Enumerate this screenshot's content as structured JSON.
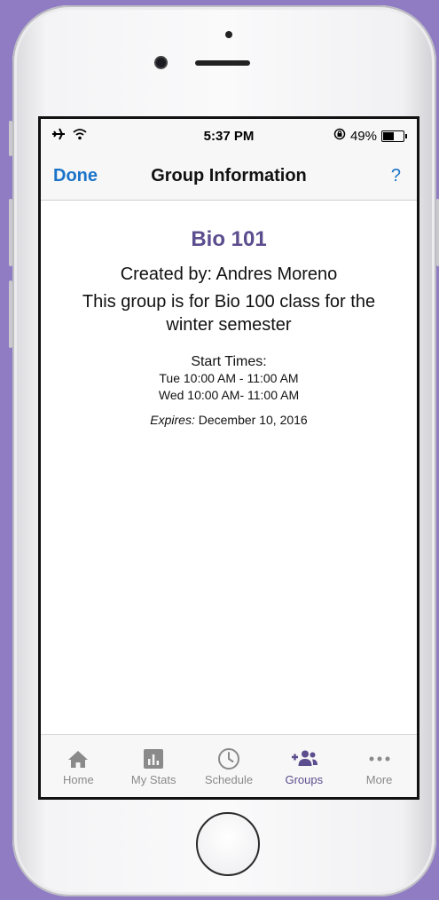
{
  "status_bar": {
    "time": "5:37 PM",
    "battery": "49%",
    "battery_level": 0.49,
    "icons": [
      "airplane-icon",
      "wifi-icon",
      "orientation-lock-icon",
      "battery-icon"
    ]
  },
  "nav": {
    "done_label": "Done",
    "title": "Group Information",
    "help_label": "?"
  },
  "group": {
    "name": "Bio 101",
    "created_by": "Created by: Andres Moreno",
    "description": "This group is for Bio 100 class for the winter semester",
    "start_times_label": "Start Times:",
    "start_times": [
      "Tue 10:00 AM - 11:00 AM",
      "Wed 10:00 AM- 11:00 AM"
    ],
    "expires_label": "Expires:",
    "expires_date": "December 10, 2016"
  },
  "tabs": [
    {
      "label": "Home",
      "icon": "home-icon"
    },
    {
      "label": "My Stats",
      "icon": "stats-icon"
    },
    {
      "label": "Schedule",
      "icon": "clock-icon"
    },
    {
      "label": "Groups",
      "icon": "add-group-icon",
      "active": true
    },
    {
      "label": "More",
      "icon": "more-icon"
    }
  ],
  "colors": {
    "background": "#8f7cc2",
    "accent_blue": "#1a73c9",
    "accent_purple": "#5c4d8e",
    "tab_inactive": "#8a8a8a"
  }
}
